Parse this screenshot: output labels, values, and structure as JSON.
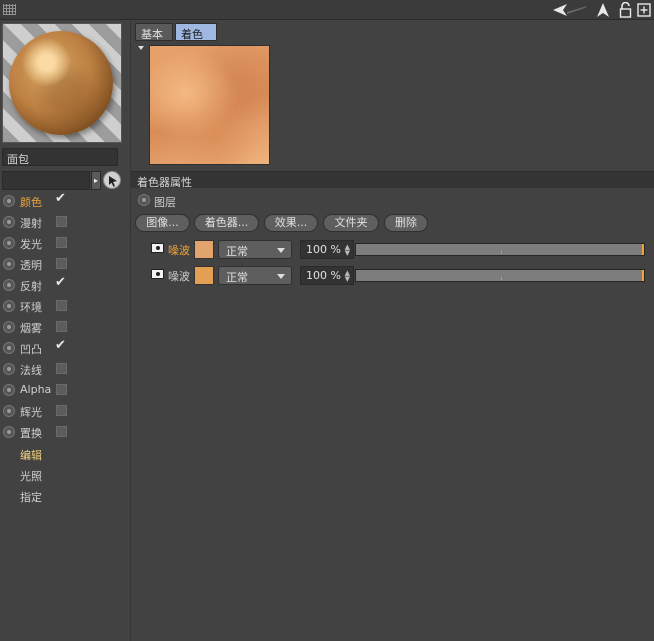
{
  "topbar": {
    "icons": [
      "grip-icon",
      "back-arrow-icon",
      "up-arrow-icon",
      "lock-icon",
      "new-panel-icon"
    ]
  },
  "material": {
    "name": "面包",
    "preview_icon": "sphere-preview"
  },
  "channels": [
    {
      "label": "颜色",
      "checked": true,
      "active": true
    },
    {
      "label": "漫射",
      "checked": false
    },
    {
      "label": "发光",
      "checked": false
    },
    {
      "label": "透明",
      "checked": false
    },
    {
      "label": "反射",
      "checked": true
    },
    {
      "label": "环境",
      "checked": false
    },
    {
      "label": "烟雾",
      "checked": false
    },
    {
      "label": "凹凸",
      "checked": true
    },
    {
      "label": "法线",
      "checked": false
    },
    {
      "label": "Alpha",
      "checked": false
    },
    {
      "label": "辉光",
      "checked": false
    },
    {
      "label": "置换",
      "checked": false
    }
  ],
  "extra_items": [
    {
      "label": "编辑",
      "selected": true
    },
    {
      "label": "光照",
      "selected": false
    },
    {
      "label": "指定",
      "selected": false
    }
  ],
  "check_glyph": "✔",
  "tabs": {
    "basic": "基本",
    "shader": "着色器"
  },
  "section": {
    "title": "着色器属性",
    "layer_label": "图层"
  },
  "buttons": {
    "image": "图像...",
    "shader": "着色器...",
    "effect": "效果...",
    "folder": "文件夹",
    "delete": "删除"
  },
  "layers": [
    {
      "name": "噪波",
      "blend": "正常",
      "opacity": "100 %",
      "active": true,
      "opacity_fraction": 1.0
    },
    {
      "name": "噪波",
      "blend": "正常",
      "opacity": "100 %",
      "active": false,
      "opacity_fraction": 1.0
    }
  ],
  "colors": {
    "accent": "#f0a53a",
    "active_tab": "#9fb8e2",
    "swatch_1": "#e0a46c",
    "swatch_2": "#e3a055"
  }
}
